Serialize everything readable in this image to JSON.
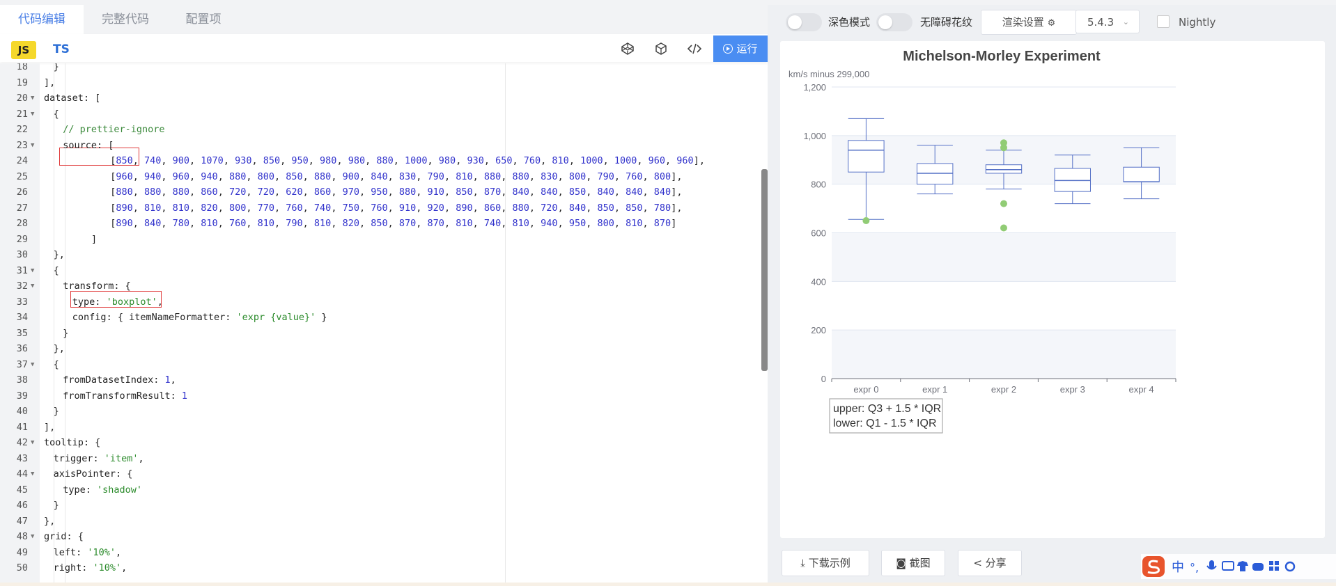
{
  "editor": {
    "tabs": [
      "代码编辑",
      "完整代码",
      "配置项"
    ],
    "lang_js": "JS",
    "lang_ts": "TS",
    "run_label": "运行",
    "lines": [
      {
        "n": "18",
        "fold": false,
        "indent": 2,
        "segs": [
          {
            "t": "}",
            "c": "p"
          }
        ]
      },
      {
        "n": "19",
        "fold": false,
        "indent": 1,
        "segs": [
          {
            "t": "],",
            "c": "p"
          }
        ]
      },
      {
        "n": "20",
        "fold": true,
        "indent": 1,
        "segs": [
          {
            "t": "dataset: [",
            "c": "p"
          }
        ]
      },
      {
        "n": "21",
        "fold": true,
        "indent": 2,
        "segs": [
          {
            "t": "{",
            "c": "p"
          }
        ]
      },
      {
        "n": "22",
        "fold": false,
        "indent": 3,
        "segs": [
          {
            "t": "// prettier-ignore",
            "c": "cmt"
          }
        ]
      },
      {
        "n": "23",
        "fold": true,
        "indent": 3,
        "segs": [
          {
            "t": "source: [",
            "c": "p"
          }
        ]
      },
      {
        "n": "24",
        "fold": false,
        "indent": 8,
        "segs": [
          {
            "t": "[",
            "c": "p"
          },
          {
            "nums": [
              850,
              740,
              900,
              1070,
              930,
              850,
              950,
              980,
              980,
              880,
              1000,
              980,
              930,
              650,
              760,
              810,
              1000,
              1000,
              960,
              960
            ]
          },
          {
            "t": "],",
            "c": "p"
          }
        ]
      },
      {
        "n": "25",
        "fold": false,
        "indent": 8,
        "segs": [
          {
            "t": "[",
            "c": "p"
          },
          {
            "nums": [
              960,
              940,
              960,
              940,
              880,
              800,
              850,
              880,
              900,
              840,
              830,
              790,
              810,
              880,
              880,
              830,
              800,
              790,
              760,
              800
            ]
          },
          {
            "t": "],",
            "c": "p"
          }
        ]
      },
      {
        "n": "26",
        "fold": false,
        "indent": 8,
        "segs": [
          {
            "t": "[",
            "c": "p"
          },
          {
            "nums": [
              880,
              880,
              880,
              860,
              720,
              720,
              620,
              860,
              970,
              950,
              880,
              910,
              850,
              870,
              840,
              840,
              850,
              840,
              840,
              840
            ]
          },
          {
            "t": "],",
            "c": "p"
          }
        ]
      },
      {
        "n": "27",
        "fold": false,
        "indent": 8,
        "segs": [
          {
            "t": "[",
            "c": "p"
          },
          {
            "nums": [
              890,
              810,
              810,
              820,
              800,
              770,
              760,
              740,
              750,
              760,
              910,
              920,
              890,
              860,
              880,
              720,
              840,
              850,
              850,
              780
            ]
          },
          {
            "t": "],",
            "c": "p"
          }
        ]
      },
      {
        "n": "28",
        "fold": false,
        "indent": 8,
        "segs": [
          {
            "t": "[",
            "c": "p"
          },
          {
            "nums": [
              890,
              840,
              780,
              810,
              760,
              810,
              790,
              810,
              820,
              850,
              870,
              870,
              810,
              740,
              810,
              940,
              950,
              800,
              810,
              870
            ]
          },
          {
            "t": "]",
            "c": "p"
          }
        ]
      },
      {
        "n": "29",
        "fold": false,
        "indent": 6,
        "segs": [
          {
            "t": "]",
            "c": "p"
          }
        ]
      },
      {
        "n": "30",
        "fold": false,
        "indent": 2,
        "segs": [
          {
            "t": "},",
            "c": "p"
          }
        ]
      },
      {
        "n": "31",
        "fold": true,
        "indent": 2,
        "segs": [
          {
            "t": "{",
            "c": "p"
          }
        ]
      },
      {
        "n": "32",
        "fold": true,
        "indent": 3,
        "segs": [
          {
            "t": "transform: {",
            "c": "p"
          }
        ]
      },
      {
        "n": "33",
        "fold": false,
        "indent": 4,
        "segs": [
          {
            "t": "type: ",
            "c": "p"
          },
          {
            "t": "'boxplot'",
            "c": "str"
          },
          {
            "t": ",",
            "c": "p"
          }
        ]
      },
      {
        "n": "34",
        "fold": false,
        "indent": 4,
        "segs": [
          {
            "t": "config: { itemNameFormatter: ",
            "c": "p"
          },
          {
            "t": "'expr {value}'",
            "c": "str"
          },
          {
            "t": " }",
            "c": "p"
          }
        ]
      },
      {
        "n": "35",
        "fold": false,
        "indent": 3,
        "segs": [
          {
            "t": "}",
            "c": "p"
          }
        ]
      },
      {
        "n": "36",
        "fold": false,
        "indent": 2,
        "segs": [
          {
            "t": "},",
            "c": "p"
          }
        ]
      },
      {
        "n": "37",
        "fold": true,
        "indent": 2,
        "segs": [
          {
            "t": "{",
            "c": "p"
          }
        ]
      },
      {
        "n": "38",
        "fold": false,
        "indent": 3,
        "segs": [
          {
            "t": "fromDatasetIndex: ",
            "c": "p"
          },
          {
            "t": "1",
            "c": "num"
          },
          {
            "t": ",",
            "c": "p"
          }
        ]
      },
      {
        "n": "39",
        "fold": false,
        "indent": 3,
        "segs": [
          {
            "t": "fromTransformResult: ",
            "c": "p"
          },
          {
            "t": "1",
            "c": "num"
          }
        ]
      },
      {
        "n": "40",
        "fold": false,
        "indent": 2,
        "segs": [
          {
            "t": "}",
            "c": "p"
          }
        ]
      },
      {
        "n": "41",
        "fold": false,
        "indent": 1,
        "segs": [
          {
            "t": "],",
            "c": "p"
          }
        ]
      },
      {
        "n": "42",
        "fold": true,
        "indent": 1,
        "segs": [
          {
            "t": "tooltip: {",
            "c": "p"
          }
        ]
      },
      {
        "n": "43",
        "fold": false,
        "indent": 2,
        "segs": [
          {
            "t": "trigger: ",
            "c": "p"
          },
          {
            "t": "'item'",
            "c": "str"
          },
          {
            "t": ",",
            "c": "p"
          }
        ]
      },
      {
        "n": "44",
        "fold": true,
        "indent": 2,
        "segs": [
          {
            "t": "axisPointer: {",
            "c": "p"
          }
        ]
      },
      {
        "n": "45",
        "fold": false,
        "indent": 3,
        "segs": [
          {
            "t": "type: ",
            "c": "p"
          },
          {
            "t": "'shadow'",
            "c": "str"
          }
        ]
      },
      {
        "n": "46",
        "fold": false,
        "indent": 2,
        "segs": [
          {
            "t": "}",
            "c": "p"
          }
        ]
      },
      {
        "n": "47",
        "fold": false,
        "indent": 1,
        "segs": [
          {
            "t": "},",
            "c": "p"
          }
        ]
      },
      {
        "n": "48",
        "fold": true,
        "indent": 1,
        "segs": [
          {
            "t": "grid: {",
            "c": "p"
          }
        ]
      },
      {
        "n": "49",
        "fold": false,
        "indent": 2,
        "segs": [
          {
            "t": "left: ",
            "c": "p"
          },
          {
            "t": "'10%'",
            "c": "str"
          },
          {
            "t": ",",
            "c": "p"
          }
        ]
      },
      {
        "n": "50",
        "fold": false,
        "indent": 2,
        "segs": [
          {
            "t": "right: ",
            "c": "p"
          },
          {
            "t": "'10%'",
            "c": "str"
          },
          {
            "t": ",",
            "c": "p"
          }
        ]
      }
    ]
  },
  "preview": {
    "dark_mode_label": "深色模式",
    "accessibility_label": "无障碍花纹",
    "render_settings_label": "渲染设置",
    "version": "5.4.3",
    "nightly_label": "Nightly",
    "download_label": "下载示例",
    "screenshot_label": "截图",
    "share_label": "分享"
  },
  "colors": {
    "accent": "#4a8df2",
    "js_badge": "#f5d82b",
    "box_stroke": "#5470c6",
    "outlier": "#91cc75",
    "highlight": "#e03a3a"
  },
  "chart_data": {
    "type": "boxplot",
    "title": "Michelson-Morley Experiment",
    "ylabel": "km/s minus 299,000",
    "ylim": [
      0,
      1200
    ],
    "yticks": [
      0,
      200,
      400,
      600,
      800,
      1000,
      1200
    ],
    "ytick_labels": [
      "0",
      "200",
      "400",
      "600",
      "800",
      "1,000",
      "1,200"
    ],
    "categories": [
      "expr 0",
      "expr 1",
      "expr 2",
      "expr 3",
      "expr 4"
    ],
    "boxes": [
      {
        "min": 655,
        "q1": 850,
        "median": 940,
        "q3": 980,
        "max": 1070
      },
      {
        "min": 760,
        "q1": 800,
        "median": 845,
        "q3": 885,
        "max": 960
      },
      {
        "min": 780,
        "q1": 845,
        "median": 860,
        "q3": 880,
        "max": 940
      },
      {
        "min": 720,
        "q1": 770,
        "median": 815,
        "q3": 865,
        "max": 920
      },
      {
        "min": 740,
        "q1": 810,
        "median": 810,
        "q3": 870,
        "max": 950
      }
    ],
    "outliers": [
      {
        "cat": 0,
        "value": 650
      },
      {
        "cat": 2,
        "value": 970
      },
      {
        "cat": 2,
        "value": 950
      },
      {
        "cat": 2,
        "value": 720
      },
      {
        "cat": 2,
        "value": 620
      }
    ],
    "annotation_lines": [
      "upper: Q3 + 1.5 * IQR",
      "lower: Q1 - 1.5 * IQR"
    ],
    "grid": true
  }
}
